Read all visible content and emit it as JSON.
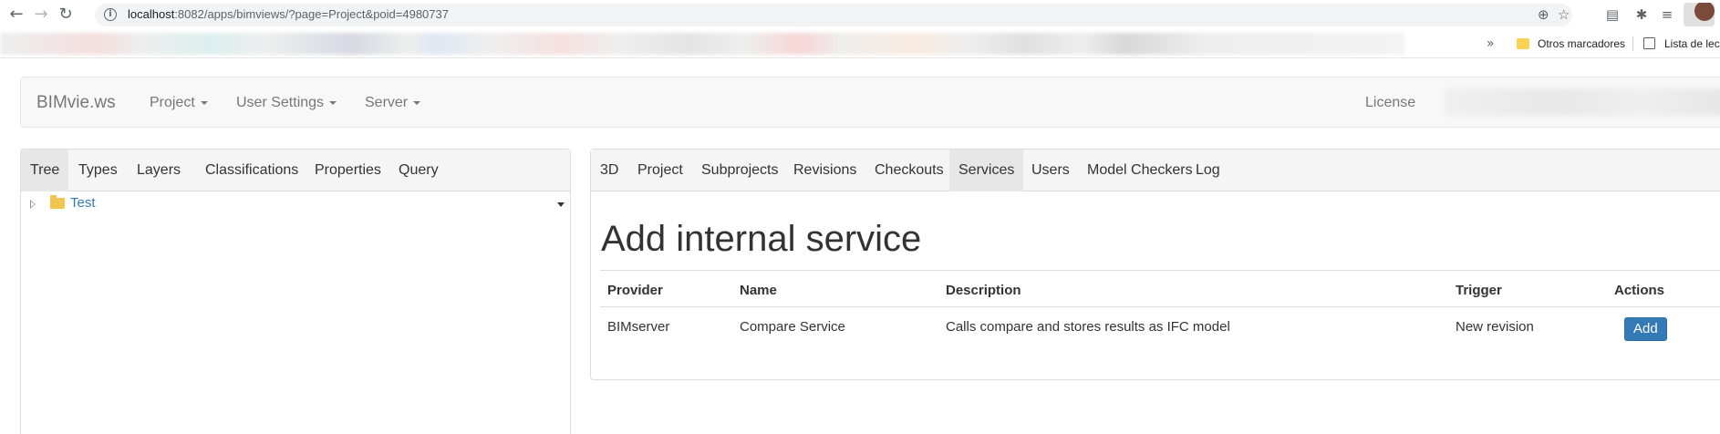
{
  "browser": {
    "url_host": "localhost",
    "url_rest": ":8082/apps/bimviews/?page=Project&poid=4980737",
    "back_icon": "arrow-left-icon",
    "forward_icon": "arrow-right-icon",
    "reload_icon": "reload-icon",
    "bookmarks": {
      "overflow_glyph": "»",
      "folder_label": "Otros marcadores",
      "reading_list_label": "Lista de lect"
    }
  },
  "navbar": {
    "brand": "BIMvie.ws",
    "menus": [
      "Project",
      "User Settings",
      "Server"
    ],
    "license": "License"
  },
  "left_panel": {
    "tabs": [
      "Tree",
      "Types",
      "Layers",
      "Classifications",
      "Properties",
      "Query"
    ],
    "active_tab": "Tree",
    "tree": [
      {
        "label": "Test"
      }
    ]
  },
  "right_panel": {
    "tabs": [
      "3D",
      "Project",
      "Subprojects",
      "Revisions",
      "Checkouts",
      "Services",
      "Users",
      "Model Checkers",
      "Log"
    ],
    "active_tab": "Services",
    "title": "Add internal service",
    "table": {
      "headers": [
        "Provider",
        "Name",
        "Description",
        "Trigger",
        "Actions"
      ],
      "rows": [
        {
          "provider": "BIMserver",
          "name": "Compare Service",
          "description": "Calls compare and stores results as IFC model",
          "trigger": "New revision",
          "action": "Add"
        }
      ]
    }
  },
  "colors": {
    "primary_button": "#337ab7",
    "link": "#337ab7",
    "navbar_bg": "#f8f8f8"
  }
}
